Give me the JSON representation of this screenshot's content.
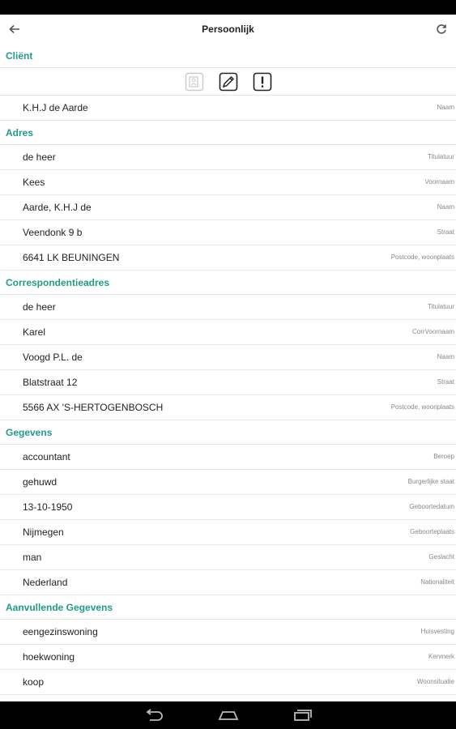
{
  "header": {
    "title": "Persoonlijk"
  },
  "sections": {
    "client": {
      "title": "Cliënt",
      "rows": [
        {
          "value": "K.H.J de Aarde",
          "label": "Naam"
        }
      ]
    },
    "adres": {
      "title": "Adres",
      "rows": [
        {
          "value": "de heer",
          "label": "Titulatuur"
        },
        {
          "value": "Kees",
          "label": "Voornaam"
        },
        {
          "value": "Aarde, K.H.J de",
          "label": "Naam"
        },
        {
          "value": "Veendonk 9 b",
          "label": "Straat"
        },
        {
          "value": "6641 LK  BEUNINGEN",
          "label": "Postcode, woonplaats"
        }
      ]
    },
    "correspondentieadres": {
      "title": "Correspondentieadres",
      "rows": [
        {
          "value": "de heer",
          "label": "Titulatuur"
        },
        {
          "value": "Karel",
          "label": "CorrVoornaam"
        },
        {
          "value": "Voogd P.L. de",
          "label": "Naam"
        },
        {
          "value": "Blatstraat 12",
          "label": "Straat"
        },
        {
          "value": "5566 AX  'S-HERTOGENBOSCH",
          "label": "Postcode, woonplaats"
        }
      ]
    },
    "gegevens": {
      "title": "Gegevens",
      "rows": [
        {
          "value": "accountant",
          "label": "Beroep"
        },
        {
          "value": "gehuwd",
          "label": "Burgerlijke staat"
        },
        {
          "value": "13-10-1950",
          "label": "Geboortedatum"
        },
        {
          "value": "Nijmegen",
          "label": "Geboorteplaats"
        },
        {
          "value": "man",
          "label": "Geslacht"
        },
        {
          "value": "Nederland",
          "label": "Nationaliteit"
        }
      ]
    },
    "aanvullende": {
      "title": "Aanvullende Gegevens",
      "rows": [
        {
          "value": "eengezinswoning",
          "label": "Huisvesting"
        },
        {
          "value": "hoekwoning",
          "label": "Kenmerk"
        },
        {
          "value": "koop",
          "label": "Woonsituatie"
        }
      ]
    }
  },
  "icons": {
    "back": "arrow-left-icon",
    "refresh": "refresh-icon",
    "contact_card": "contact-card-icon",
    "edit": "edit-icon",
    "alert": "alert-icon",
    "nav_back": "nav-back-icon",
    "nav_home": "nav-home-icon",
    "nav_recents": "nav-recents-icon"
  },
  "colors": {
    "section_header": "#1f9b8a"
  }
}
